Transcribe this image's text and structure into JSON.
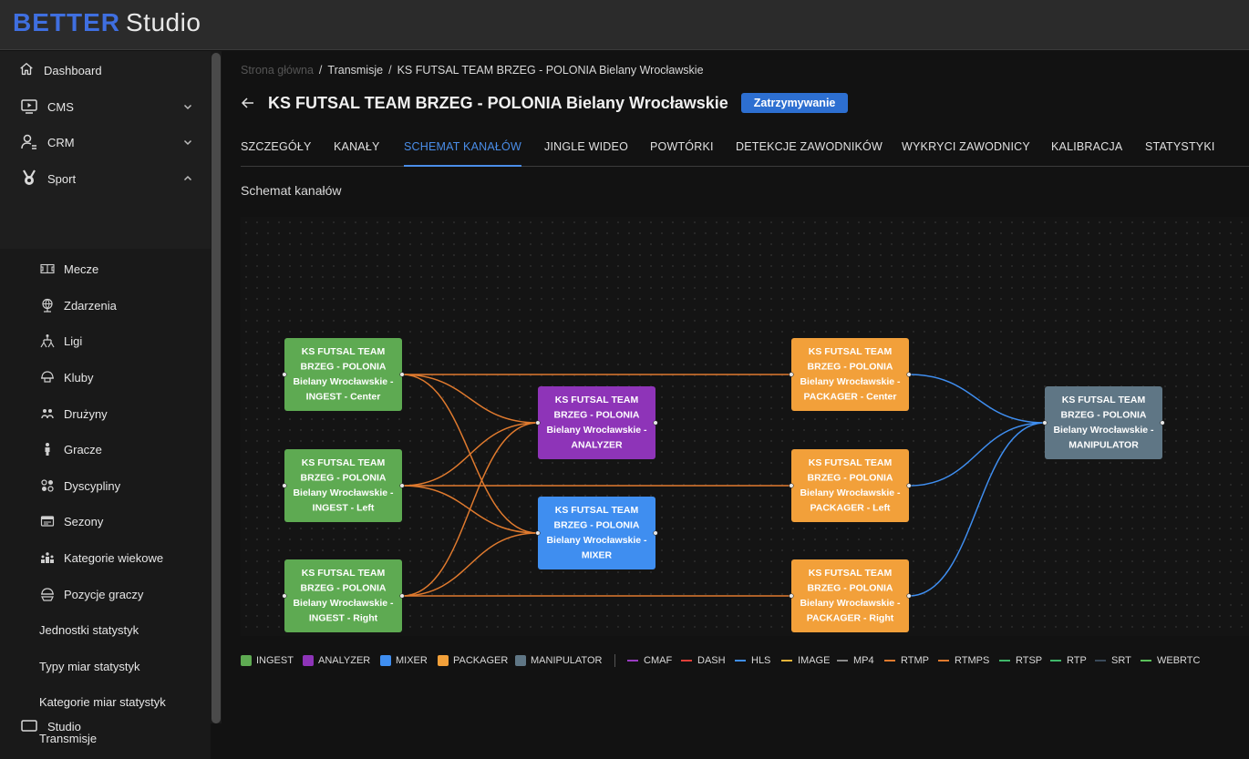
{
  "app": {
    "logo_brand": "BETTER",
    "logo_product": "Studio"
  },
  "sidebar": {
    "top_items": [
      {
        "label": "Dashboard",
        "icon": "home-icon"
      },
      {
        "label": "CMS",
        "icon": "play-screen-icon"
      },
      {
        "label": "CRM",
        "icon": "user-list-icon"
      },
      {
        "label": "Sport",
        "icon": "medal-icon"
      }
    ],
    "sport_items": [
      {
        "label": "Mecze",
        "icon": "pitch-icon"
      },
      {
        "label": "Zdarzenia",
        "icon": "globe-icon"
      },
      {
        "label": "Ligi",
        "icon": "bracket-icon"
      },
      {
        "label": "Kluby",
        "icon": "helmet-icon"
      },
      {
        "label": "Drużyny",
        "icon": "team-icon"
      },
      {
        "label": "Gracze",
        "icon": "player-icon"
      },
      {
        "label": "Dyscypliny",
        "icon": "disciplines-icon"
      },
      {
        "label": "Sezony",
        "icon": "calendar-card-icon"
      },
      {
        "label": "Kategorie wiekowe",
        "icon": "age-groups-icon"
      },
      {
        "label": "Pozycje graczy",
        "icon": "positions-icon"
      },
      {
        "label": "Jednostki statystyk",
        "icon": ""
      },
      {
        "label": "Typy miar statystyk",
        "icon": ""
      },
      {
        "label": "Kategorie miar statystyk",
        "icon": ""
      },
      {
        "label": "Transmisje",
        "icon": ""
      }
    ],
    "partial_item": "Studio"
  },
  "breadcrumb": {
    "home": "Strona główna",
    "section": "Transmisje",
    "current": "KS FUTSAL TEAM BRZEG - POLONIA Bielany Wrocławskie"
  },
  "header": {
    "title": "KS FUTSAL TEAM BRZEG - POLONIA Bielany Wrocławskie",
    "status": "Zatrzymywanie"
  },
  "tabs": [
    {
      "label": "SZCZEGÓŁY",
      "active": false
    },
    {
      "label": "KANAŁY",
      "active": false
    },
    {
      "label": "SCHEMAT KANAŁÓW",
      "active": true
    },
    {
      "label": "JINGLE WIDEO",
      "active": false
    },
    {
      "label": "POWTÓRKI",
      "active": false
    },
    {
      "label": "DETEKCJE ZAWODNIKÓW",
      "active": false
    },
    {
      "label": "WYKRYCI ZAWODNICY",
      "active": false
    },
    {
      "label": "KALIBRACJA",
      "active": false
    },
    {
      "label": "STATYSTYKI",
      "active": false
    }
  ],
  "section_title": "Schemat kanałów",
  "colors": {
    "INGEST": "#5eaa52",
    "ANALYZER": "#8e34b8",
    "MIXER": "#3f8ef0",
    "PACKAGER": "#f2a03a",
    "MANIPULATOR": "#5f7685",
    "CMAF": "#9a3cc2",
    "DASH": "#e0403a",
    "HLS": "#3f8ef0",
    "IMAGE": "#e8b43a",
    "MP4": "#8a8a8a",
    "RTMP": "#e07a2e",
    "RTMPS": "#e07a2e",
    "RTSP": "#3fb86a",
    "RTP": "#3fb86a",
    "SRT": "#3a4a5a",
    "WEBRTC": "#5ac05a"
  },
  "nodes": [
    {
      "id": "ingest-center",
      "type": "INGEST",
      "lines": [
        "KS FUTSAL TEAM",
        "BRZEG - POLONIA",
        "Bielany Wrocławskie -",
        "INGEST - Center"
      ]
    },
    {
      "id": "ingest-left",
      "type": "INGEST",
      "lines": [
        "KS FUTSAL TEAM",
        "BRZEG - POLONIA",
        "Bielany Wrocławskie -",
        "INGEST - Left"
      ]
    },
    {
      "id": "ingest-right",
      "type": "INGEST",
      "lines": [
        "KS FUTSAL TEAM",
        "BRZEG - POLONIA",
        "Bielany Wrocławskie -",
        "INGEST - Right"
      ]
    },
    {
      "id": "analyzer",
      "type": "ANALYZER",
      "lines": [
        "KS FUTSAL TEAM",
        "BRZEG - POLONIA",
        "Bielany Wrocławskie -",
        "ANALYZER"
      ]
    },
    {
      "id": "mixer",
      "type": "MIXER",
      "lines": [
        "KS FUTSAL TEAM",
        "BRZEG - POLONIA",
        "Bielany Wrocławskie -",
        "MIXER"
      ]
    },
    {
      "id": "packager-center",
      "type": "PACKAGER",
      "lines": [
        "KS FUTSAL TEAM",
        "BRZEG - POLONIA",
        "Bielany Wrocławskie -",
        "PACKAGER - Center"
      ]
    },
    {
      "id": "packager-left",
      "type": "PACKAGER",
      "lines": [
        "KS FUTSAL TEAM",
        "BRZEG - POLONIA",
        "Bielany Wrocławskie -",
        "PACKAGER - Left"
      ]
    },
    {
      "id": "packager-right",
      "type": "PACKAGER",
      "lines": [
        "KS FUTSAL TEAM",
        "BRZEG - POLONIA",
        "Bielany Wrocławskie -",
        "PACKAGER - Right"
      ]
    },
    {
      "id": "manipulator",
      "type": "MANIPULATOR",
      "lines": [
        "KS FUTSAL TEAM",
        "BRZEG - POLONIA",
        "Bielany Wrocławskie -",
        "MANIPULATOR"
      ]
    }
  ],
  "edges": [
    {
      "from": "ingest-center",
      "to": "packager-center",
      "protocol": "RTMP"
    },
    {
      "from": "ingest-center",
      "to": "analyzer",
      "protocol": "RTMP"
    },
    {
      "from": "ingest-center",
      "to": "mixer",
      "protocol": "RTMP"
    },
    {
      "from": "ingest-left",
      "to": "analyzer",
      "protocol": "RTMP"
    },
    {
      "from": "ingest-left",
      "to": "mixer",
      "protocol": "RTMP"
    },
    {
      "from": "ingest-left",
      "to": "packager-left",
      "protocol": "RTMP"
    },
    {
      "from": "ingest-right",
      "to": "analyzer",
      "protocol": "RTMP"
    },
    {
      "from": "ingest-right",
      "to": "mixer",
      "protocol": "RTMP"
    },
    {
      "from": "ingest-right",
      "to": "packager-right",
      "protocol": "RTMP"
    },
    {
      "from": "packager-center",
      "to": "manipulator",
      "protocol": "HLS"
    },
    {
      "from": "packager-left",
      "to": "manipulator",
      "protocol": "HLS"
    },
    {
      "from": "packager-right",
      "to": "manipulator",
      "protocol": "HLS"
    }
  ],
  "legend": {
    "node_types": [
      "INGEST",
      "ANALYZER",
      "MIXER",
      "PACKAGER",
      "MANIPULATOR"
    ],
    "protocols": [
      "CMAF",
      "DASH",
      "HLS",
      "IMAGE",
      "MP4",
      "RTMP",
      "RTMPS",
      "RTSP",
      "RTP",
      "SRT",
      "WEBRTC"
    ]
  }
}
